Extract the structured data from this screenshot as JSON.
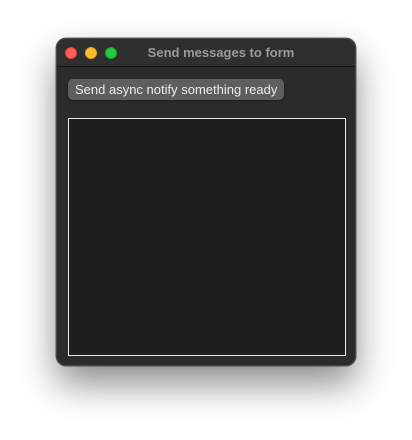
{
  "window": {
    "title": "Send messages to form"
  },
  "toolbar": {
    "notify_button_label": "Send async notify something ready"
  },
  "messages": {
    "value": ""
  },
  "colors": {
    "close": "#fe5f57",
    "minimize": "#febc2e",
    "zoom": "#28c840",
    "window_bg": "#2b2b2b",
    "text_area_bg": "#1e1e1e",
    "text_area_border": "#e8e8e8",
    "button_bg": "#5e5e5e"
  }
}
